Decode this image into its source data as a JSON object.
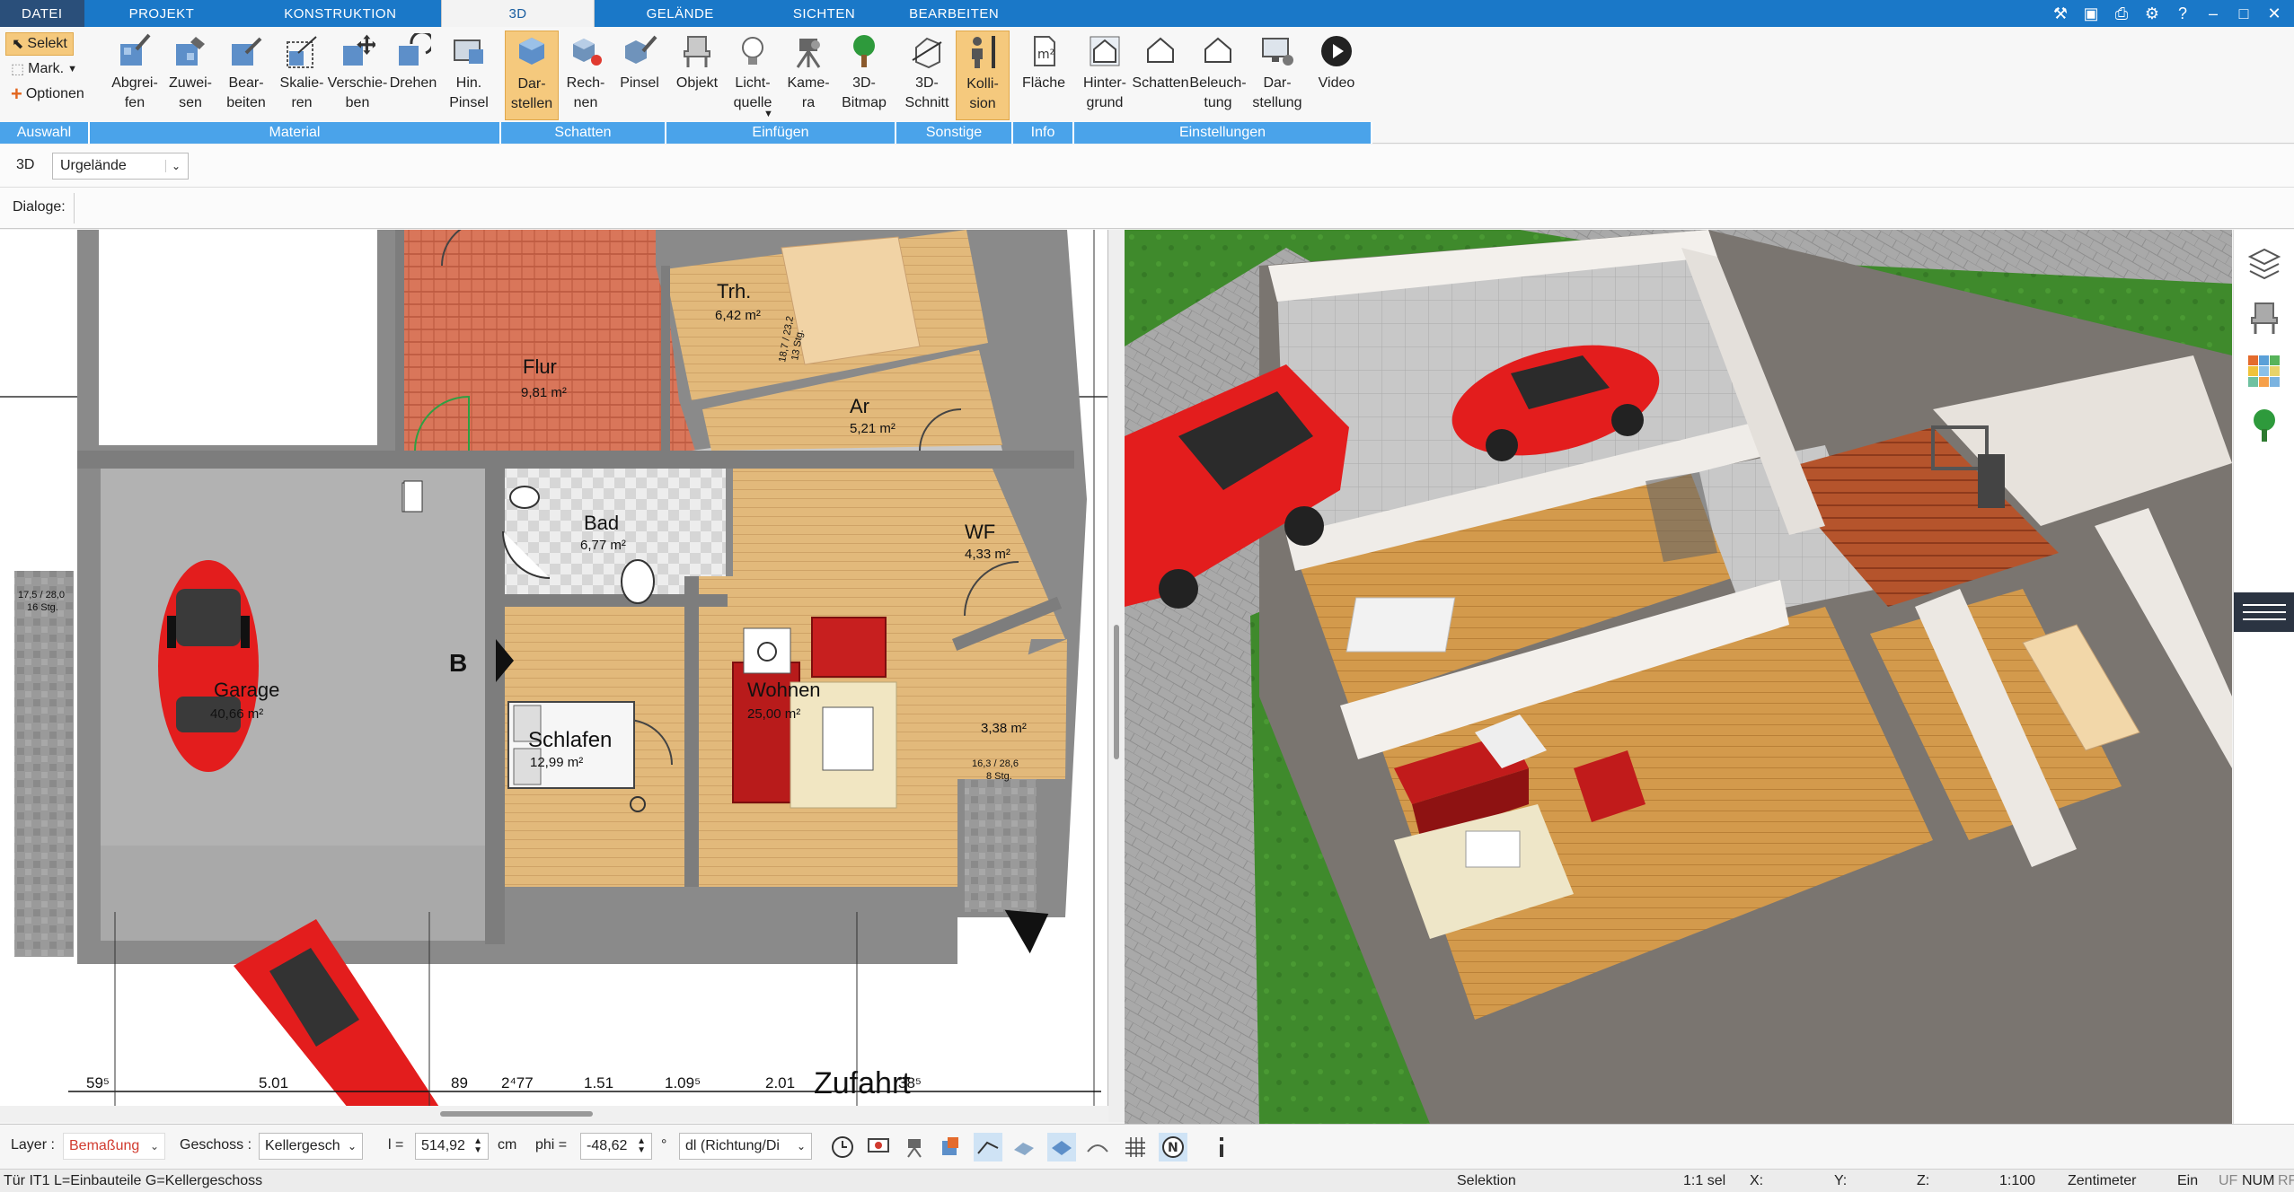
{
  "tabs": {
    "file": "DATEI",
    "items": [
      "PROJEKT",
      "KONSTRUKTION",
      "3D",
      "GELÄNDE",
      "SICHTEN",
      "BEARBEITEN"
    ],
    "active": "3D"
  },
  "ribbon": {
    "auswahl": {
      "label": "Auswahl",
      "select": "Selekt",
      "mark": "Mark.",
      "options": "Optionen"
    },
    "material": {
      "label": "Material",
      "buttons": [
        "Abgrei-\nfen",
        "Zuwei-\nsen",
        "Bear-\nbeiten",
        "Skalie-\nren",
        "Verschie-\nben",
        "Drehen",
        "Hin.\nPinsel"
      ]
    },
    "schatten": {
      "label": "Schatten",
      "buttons": [
        "Dar-\nstellen",
        "Rech-\nnen",
        "Pinsel"
      ]
    },
    "einfuegen": {
      "label": "Einfügen",
      "buttons": [
        "Objekt",
        "Licht-\nquelle",
        "Kame-\nra",
        "3D-\nBitmap"
      ]
    },
    "sonstige": {
      "label": "Sonstige",
      "buttons": [
        "3D-\nSchnitt",
        "Kolli-\nsion"
      ]
    },
    "info": {
      "label": "Info",
      "buttons": [
        "Fläche"
      ]
    },
    "einstellungen": {
      "label": "Einstellungen",
      "buttons": [
        "Hinter-\ngrund",
        "Schatten",
        "Beleuch-\ntung",
        "Dar-\nstellung",
        "Video"
      ]
    }
  },
  "subbar": {
    "view_label": "3D",
    "terrain": "Urgelände",
    "dialog_label": "Dialoge:"
  },
  "plan": {
    "rooms": [
      {
        "name": "Flur",
        "area": "9,81 m²"
      },
      {
        "name": "Trh.",
        "area": "6,42 m²"
      },
      {
        "name": "Ar",
        "area": "5,21 m²"
      },
      {
        "name": "Bad",
        "area": "6,77 m²"
      },
      {
        "name": "WF",
        "area": "4,33 m²"
      },
      {
        "name": "Garage",
        "area": "40,66 m²"
      },
      {
        "name": "Wohnen",
        "area": "25,00 m²"
      },
      {
        "name": "Schlafen",
        "area": "12,99 m²"
      },
      {
        "name": "",
        "area": "3,38 m²"
      }
    ],
    "stair_notes": [
      "17,5 / 28,0",
      "16 Stg.",
      "16,3 / 28,6",
      "8 Stg.",
      "18,7 / 23,2",
      "13 Stg."
    ],
    "section_mark": "B",
    "street": "Zufahrt",
    "dimensions": [
      "59⁵",
      "5.01",
      "89",
      "2⁴77",
      "1.51",
      "1.09⁵",
      "2.01",
      "38⁵"
    ]
  },
  "status": {
    "layer_label": "Layer :",
    "layer_value": "Bemaßung",
    "floor_label": "Geschoss :",
    "floor_value": "Kellergesch",
    "length_label": "l =",
    "length_value": "514,92",
    "length_unit": "cm",
    "phi_label": "phi =",
    "phi_value": "-48,62",
    "phi_unit": "°",
    "direction": "dl (Richtung/Di"
  },
  "info": {
    "object": "Tür IT1 L=Einbauteile G=Kellergeschoss",
    "mode": "Selektion",
    "sel": "1:1 sel",
    "x": "X:",
    "y": "Y:",
    "z": "Z:",
    "scale": "1:100",
    "unit": "Zentimeter",
    "insert": "Ein",
    "uf": "UF",
    "num": "NUM",
    "rf": "RF"
  },
  "colors": {
    "ribbon_blue": "#1a78c8",
    "group_label": "#4aa3ea",
    "active_btn": "#f5c97d",
    "car_red": "#e31d1d",
    "wood": "#e2b97b",
    "roof_tile": "#d9765a",
    "grass": "#3f8a2c"
  }
}
